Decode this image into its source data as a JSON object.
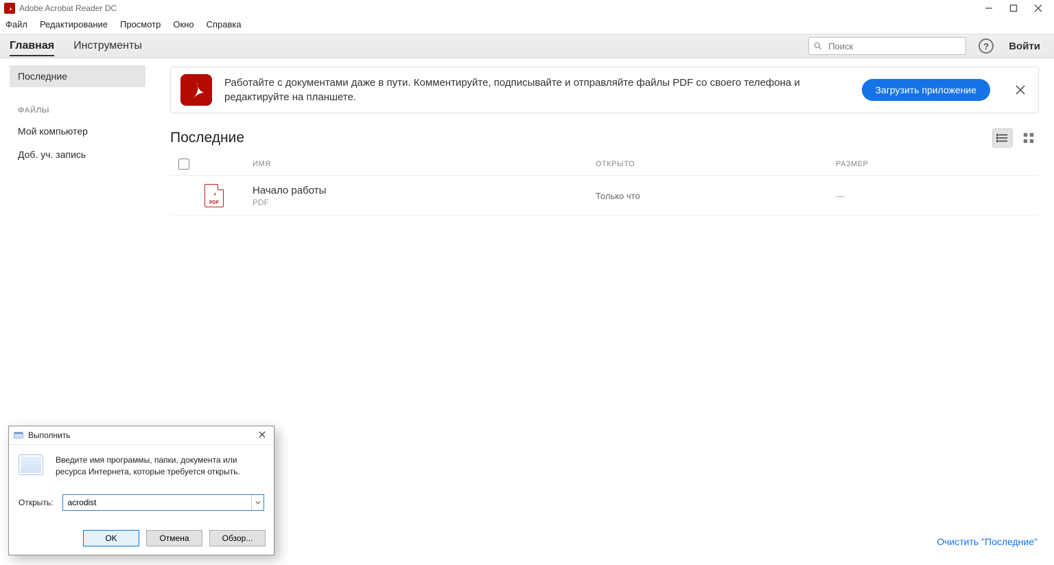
{
  "title": "Adobe Acrobat Reader DC",
  "menu": [
    "Файл",
    "Редактирование",
    "Просмотр",
    "Окно",
    "Справка"
  ],
  "tabs": {
    "main": "Главная",
    "tools": "Инструменты"
  },
  "search_placeholder": "Поиск",
  "login_label": "Войти",
  "sidebar": {
    "recent": "Последние",
    "section_files": "ФАЙЛЫ",
    "my_computer": "Мой компьютер",
    "add_account": "Доб. уч. запись"
  },
  "banner": {
    "text": "Работайте с документами даже в пути. Комментируйте, подписывайте и отправляйте файлы PDF со своего телефона и редактируйте на планшете.",
    "button": "Загрузить приложение"
  },
  "list": {
    "title": "Последние",
    "columns": {
      "name": "ИМЯ",
      "opened": "ОТКРЫТО",
      "size": "РАЗМЕР"
    },
    "rows": [
      {
        "name": "Начало работы",
        "type": "PDF",
        "opened": "Только что",
        "size": "—"
      }
    ]
  },
  "footer_link": "Очистить \"Последние\"",
  "run_dialog": {
    "title": "Выполнить",
    "hint": "Введите имя программы, папки, документа или ресурса Интернета, которые требуется открыть.",
    "label": "Открыть:",
    "value": "acrodist",
    "ok": "OK",
    "cancel": "Отмена",
    "browse": "Обзор..."
  }
}
